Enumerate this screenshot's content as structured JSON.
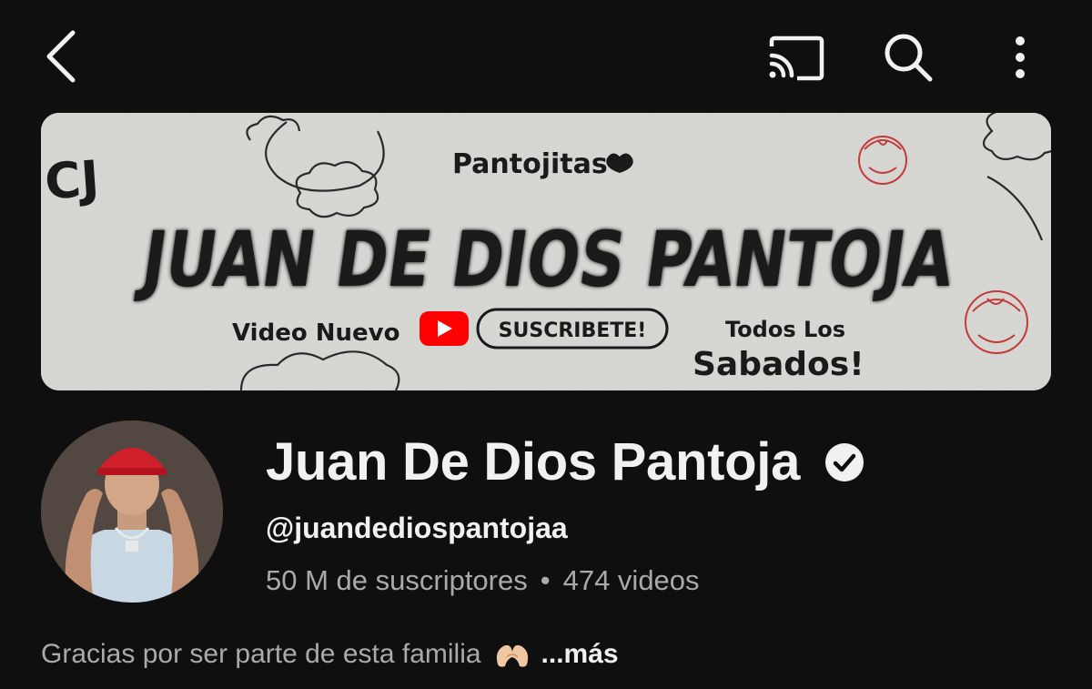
{
  "topbar": {
    "back_icon": "chevron-left-icon",
    "cast_icon": "cast-icon",
    "search_icon": "search-icon",
    "more_icon": "more-vertical-icon"
  },
  "banner": {
    "logo_text": "CJ",
    "tag_text": "Pantojitas",
    "title_graffiti": "JUAN DE DIOS PANTOJA",
    "left_caption": "Video Nuevo",
    "subscribe_label": "SUSCRIBETE!",
    "right_caption_line1": "Todos Los",
    "right_caption_line2": "Sabados!"
  },
  "channel": {
    "name": "Juan De Dios Pantoja",
    "verified_icon": "verified-check-icon",
    "handle": "@juandediospantojaa",
    "subscribers": "50 M de suscriptores",
    "separator": "•",
    "videos": "474 videos"
  },
  "description": {
    "text": "Gracias por ser parte de esta familia",
    "emoji": "heart-hands-icon",
    "more_label": "...más"
  },
  "colors": {
    "background": "#0f0f0f",
    "primary_text": "#f1f1f1",
    "secondary_text": "#aaaaaa",
    "youtube_red": "#ff0000"
  }
}
